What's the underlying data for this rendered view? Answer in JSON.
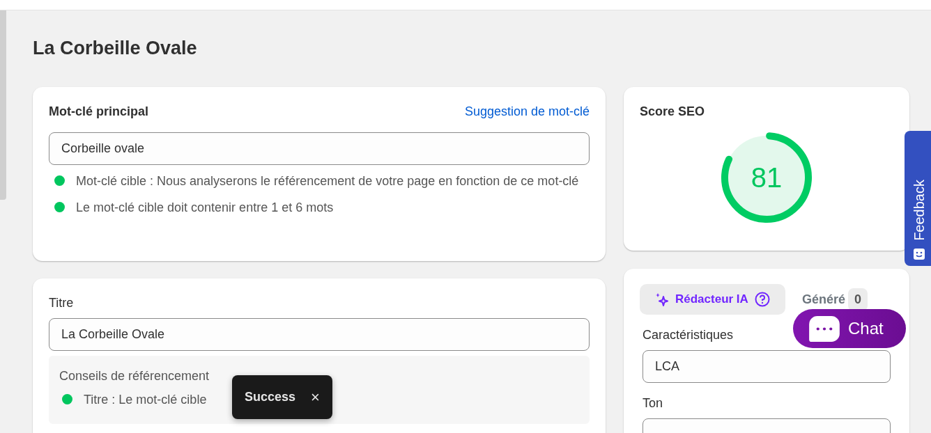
{
  "page_title": "La Corbeille Ovale",
  "keyword_card": {
    "label": "Mot-clé principal",
    "suggestion_link": "Suggestion de mot-clé",
    "value": "Corbeille ovale",
    "hints": [
      {
        "text": "Mot-clé cible : Nous analyserons le référencement de votre page en fonction de ce mot-clé",
        "color": "#00c65e"
      },
      {
        "text": "Le mot-clé cible doit contenir entre 1 et 6 mots",
        "color": "#00c65e"
      }
    ]
  },
  "title_card": {
    "label": "Titre",
    "value": "La Corbeille Ovale",
    "tips_heading": "Conseils de référencement",
    "tips": [
      {
        "text": "Titre : Le mot-clé cible",
        "color": "#00c65e"
      }
    ]
  },
  "seo_card": {
    "label": "Score SEO",
    "score": "81",
    "level": 0.81
  },
  "ai_card": {
    "writer_button": "Rédacteur IA",
    "generated_label": "Généré",
    "generated_count": "0",
    "fields": [
      {
        "label": "Caractéristiques",
        "value": "LCA"
      },
      {
        "label": "Ton"
      }
    ]
  },
  "toast": {
    "text": "Success",
    "close": "×"
  },
  "feedback_tab": "Feedback",
  "chat_button": "Chat"
}
